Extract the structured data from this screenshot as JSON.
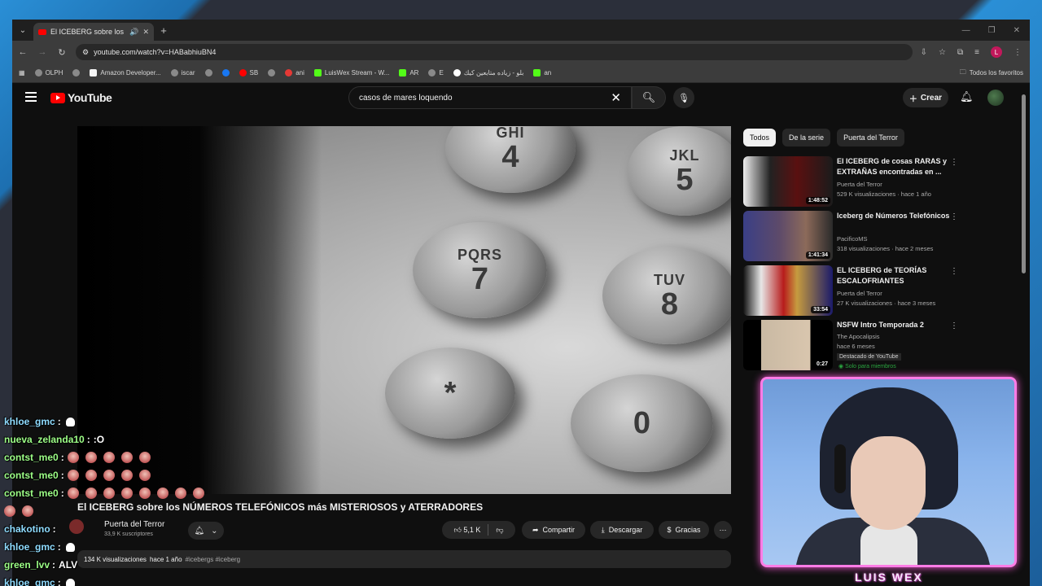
{
  "browser": {
    "tab_title": "El ICEBERG sobre los NÚMERO",
    "new_tab": "+",
    "url": "youtube.com/watch?v=HABabhiuBN4",
    "bookmarks": [
      {
        "label": "OLPH"
      },
      {
        "label": ""
      },
      {
        "label": "Amazon Developer..."
      },
      {
        "label": "iscar"
      },
      {
        "label": ""
      },
      {
        "label": ""
      },
      {
        "label": "SB"
      },
      {
        "label": ""
      },
      {
        "label": "ani"
      },
      {
        "label": "LuisWex Stream - W..."
      },
      {
        "label": "AR"
      },
      {
        "label": "E"
      },
      {
        "label": "بلو - زياده متابعين كيك"
      },
      {
        "label": "an"
      }
    ],
    "all_bookmarks": "Todos los favoritos"
  },
  "youtube": {
    "logo_text": "YouTube",
    "search_query": "casos de mares loquendo",
    "create_label": "Crear"
  },
  "video": {
    "title": "El ICEBERG sobre los NÚMEROS TELEFÓNICOS más MISTERIOSOS y ATERRADORES",
    "channel": "Puerta del Terror",
    "subscribers": "33,9 K suscriptores",
    "likes": "5,1 K",
    "share_label": "Compartir",
    "download_label": "Descargar",
    "thanks_label": "Gracias",
    "views": "134 K visualizaciones",
    "age": "hace 1 año",
    "tags": "#icebergs #iceberg",
    "keys": [
      {
        "letters": "GHI",
        "digit": "4"
      },
      {
        "letters": "JKL",
        "digit": "5"
      },
      {
        "letters": "PQRS",
        "digit": "7"
      },
      {
        "letters": "TUV",
        "digit": "8"
      },
      {
        "letters": "",
        "digit": "*"
      },
      {
        "letters": "",
        "digit": "0"
      }
    ]
  },
  "sidebar": {
    "chips": [
      "Todos",
      "De la serie",
      "Puerta del Terror"
    ],
    "recommendations": [
      {
        "title": "El ICEBERG de cosas RARAS y EXTRAÑAS encontradas en ...",
        "channel": "Puerta del Terror",
        "meta": "529 K visualizaciones · hace 1 año",
        "duration": "1:48:52",
        "thumb_color": "#2a1a1a"
      },
      {
        "title": "Iceberg de Números Telefónicos",
        "channel": "PacificoMS",
        "meta": "318 visualizaciones · hace 2 meses",
        "duration": "1:41:34",
        "thumb_color": "#3a2c2c"
      },
      {
        "title": "EL ICEBERG de TEORÍAS ESCALOFRIANTES",
        "channel": "Puerta del Terror",
        "meta": "27 K visualizaciones · hace 3 meses",
        "duration": "33:54",
        "thumb_color": "#401010"
      },
      {
        "title": "NSFW Intro Temporada 2",
        "channel": "The Apocalipsis",
        "meta": "hace 6 meses",
        "duration": "0:27",
        "badge": "Destacado de YouTube",
        "members": "Solo para miembros",
        "thumb_color": "#c9b9a3"
      }
    ]
  },
  "chat": [
    {
      "user": "khloe_gmc",
      "msg": "",
      "emotes": 0,
      "ghost": true,
      "color": "blue"
    },
    {
      "user": "nueva_zelanda10",
      "msg": ":O",
      "emotes": 0,
      "ghost": false,
      "color": "green"
    },
    {
      "user": "contst_me0",
      "msg": "",
      "emotes": 5,
      "ghost": false,
      "color": "green"
    },
    {
      "user": "contst_me0",
      "msg": "",
      "emotes": 5,
      "ghost": false,
      "color": "green"
    },
    {
      "user": "contst_me0",
      "msg": "",
      "emotes": 8,
      "ghost": false,
      "color": "green"
    },
    {
      "user": "",
      "msg": "",
      "emotes": 2,
      "ghost": false,
      "color": "green"
    },
    {
      "user": "chakotino",
      "msg": "",
      "emotes": 0,
      "ghost": false,
      "color": "blue"
    },
    {
      "user": "khloe_gmc",
      "msg": "",
      "emotes": 0,
      "ghost": true,
      "color": "blue"
    },
    {
      "user": "green_lvv",
      "msg": "ALV",
      "emotes": 0,
      "ghost": false,
      "color": "green"
    },
    {
      "user": "khloe_gmc",
      "msg": "",
      "emotes": 0,
      "ghost": true,
      "color": "blue"
    }
  ],
  "webcam": {
    "streamer_name": "LUIS WEX"
  }
}
